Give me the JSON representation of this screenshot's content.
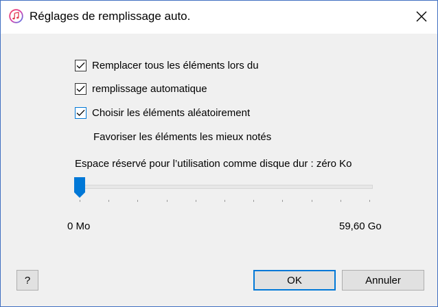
{
  "window": {
    "title": "Réglages de remplissage auto."
  },
  "icons": {
    "app": "itunes-note-icon",
    "close": "close-icon",
    "check": "checkmark-icon",
    "slider_thumb": "slider-thumb"
  },
  "options": [
    {
      "label": "Remplacer tous les éléments lors du",
      "checked": true
    },
    {
      "label": "remplissage automatique",
      "checked": true
    },
    {
      "label": "Choisir les éléments aléatoirement",
      "checked": true
    }
  ],
  "favor_label": "Favoriser les éléments les mieux notés",
  "disk": {
    "reserved_label": "Espace réservé pour l’utilisation comme disque dur : zéro Ko",
    "slider_value": 0,
    "min_label": "0 Mo",
    "max_label": "59,60 Go",
    "tick_count": 11
  },
  "buttons": {
    "help": "?",
    "ok": "OK",
    "cancel": "Annuler"
  },
  "colors": {
    "accent": "#0078d7",
    "titlebar": "#ffffff",
    "body": "#f0f0f0",
    "window_border": "#3f6ec1",
    "app_icon_ring": "#e6365a"
  }
}
